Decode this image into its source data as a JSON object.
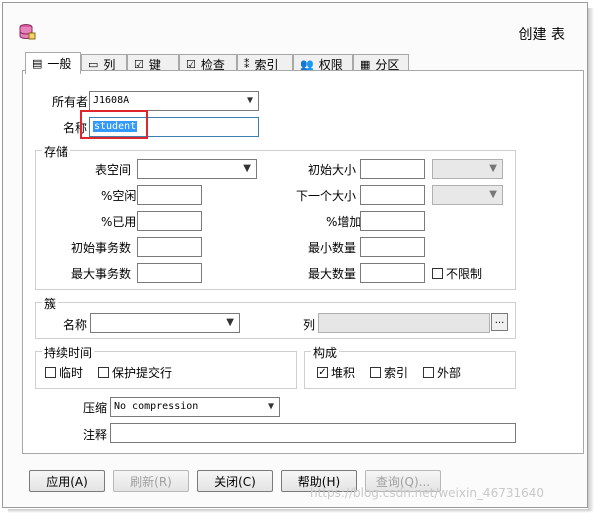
{
  "window": {
    "title": "创建 表"
  },
  "tabs": [
    {
      "label": "一般",
      "icon": "general-icon"
    },
    {
      "label": "列",
      "icon": "columns-icon"
    },
    {
      "label": "键",
      "icon": "keys-icon"
    },
    {
      "label": "检查",
      "icon": "check-icon"
    },
    {
      "label": "索引",
      "icon": "index-icon"
    },
    {
      "label": "权限",
      "icon": "users-icon"
    },
    {
      "label": "分区",
      "icon": "partition-icon"
    }
  ],
  "general": {
    "owner_label": "所有者",
    "owner_value": "J1608A",
    "name_label": "名称",
    "name_value": "student"
  },
  "storage": {
    "title": "存储",
    "tablespace_label": "表空间",
    "tablespace_value": "",
    "pctfree_label": "%空闲",
    "pctfree_value": "",
    "pctused_label": "%已用",
    "pctused_value": "",
    "initrans_label": "初始事务数",
    "initrans_value": "",
    "maxtrans_label": "最大事务数",
    "maxtrans_value": "",
    "initial_label": "初始大小",
    "initial_value": "",
    "next_label": "下一个大小",
    "next_value": "",
    "pctincrease_label": "%增加",
    "pctincrease_value": "",
    "minextents_label": "最小数量",
    "minextents_value": "",
    "maxextents_label": "最大数量",
    "maxextents_value": "",
    "unlimited_label": "不限制",
    "unlimited_checked": false
  },
  "cluster": {
    "title": "簇",
    "name_label": "名称",
    "name_value": "",
    "columns_label": "列",
    "columns_value": "",
    "browse_label": "..."
  },
  "duration": {
    "title": "持续时间",
    "temporary_label": "临时",
    "temporary_checked": false,
    "preserve_label": "保护提交行",
    "preserve_checked": false
  },
  "organization": {
    "title": "构成",
    "heap_label": "堆积",
    "heap_checked": true,
    "index_label": "索引",
    "index_checked": false,
    "external_label": "外部",
    "external_checked": false
  },
  "compression": {
    "label": "压缩",
    "value": "No compression"
  },
  "comment": {
    "label": "注释",
    "value": ""
  },
  "buttons": {
    "apply": "应用(A)",
    "refresh": "刷新(R)",
    "close": "关闭(C)",
    "help": "帮助(H)",
    "query": "查询(Q)..."
  },
  "watermark": "https://blog.csdn.net/weixin_46731640"
}
